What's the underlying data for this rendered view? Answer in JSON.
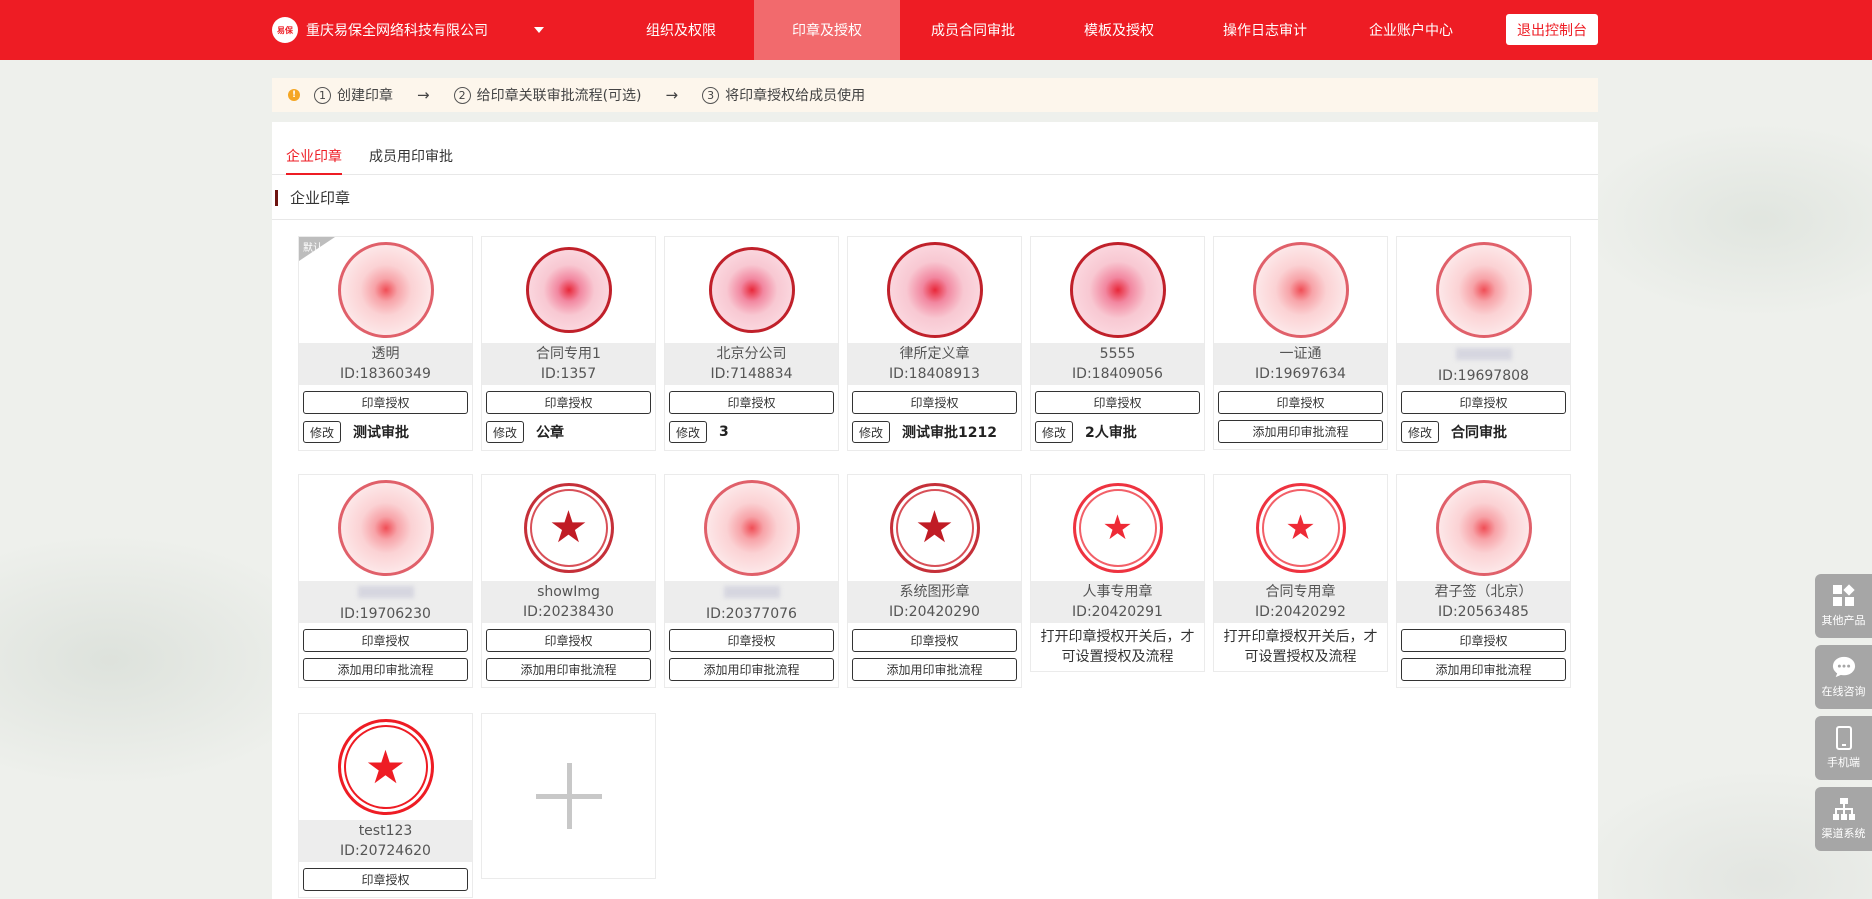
{
  "header": {
    "logo_text": "易保",
    "company_name": "重庆易保全网络科技有限公司",
    "nav": [
      "组织及权限",
      "印章及授权",
      "成员合同审批",
      "模板及授权",
      "操作日志审计",
      "企业账户中心"
    ],
    "active_nav_index": 1,
    "exit_label": "退出控制台"
  },
  "steps": [
    {
      "num": "1",
      "label": "创建印章"
    },
    {
      "num": "2",
      "label": "给印章关联审批流程(可选)"
    },
    {
      "num": "3",
      "label": "将印章授权给成员使用"
    }
  ],
  "tabs": [
    "企业印章",
    "成员用印审批"
  ],
  "section_title": "企业印章",
  "colors": {
    "brand": "#ee1c24",
    "active_nav": "#f26a6d",
    "steps_bg": "#fdf6ec"
  },
  "labels": {
    "authorize": "印章授权",
    "edit": "修改",
    "add_flow": "添加用印审批流程",
    "notice": "打开印章授权开关后，才可设置授权及流程",
    "default_badge": "默认"
  },
  "seals": [
    {
      "name": "透明",
      "id": "ID:18360349",
      "flow": "测试审批"
    },
    {
      "name": "合同专用1",
      "id": "ID:1357",
      "flow": "公章"
    },
    {
      "name": "北京分公司",
      "id": "ID:7148834",
      "flow": "3"
    },
    {
      "name": "律所定义章",
      "id": "ID:18408913",
      "flow": "测试审批1212"
    },
    {
      "name": "5555",
      "id": "ID:18409056",
      "flow": "2人审批"
    },
    {
      "name": "一证通",
      "id": "ID:19697634",
      "flow": ""
    },
    {
      "name": "",
      "id": "ID:19697808",
      "flow": "合同审批"
    },
    {
      "name": "",
      "id": "ID:19706230",
      "flow": ""
    },
    {
      "name": "showImg",
      "id": "ID:20238430",
      "flow": ""
    },
    {
      "name": "",
      "id": "ID:20377076",
      "flow": ""
    },
    {
      "name": "系统图形章",
      "id": "ID:20420290",
      "flow": ""
    },
    {
      "name": "人事专用章",
      "id": "ID:20420291",
      "flow": ""
    },
    {
      "name": "合同专用章",
      "id": "ID:20420292",
      "flow": ""
    },
    {
      "name": "君子签（北京）",
      "id": "ID:20563485",
      "flow": ""
    },
    {
      "name": "test123",
      "id": "ID:20724620",
      "flow": ""
    }
  ],
  "side_widgets": [
    {
      "label": "其他产品",
      "icon": "grid-icon"
    },
    {
      "label": "在线咨询",
      "icon": "chat-icon"
    },
    {
      "label": "手机端",
      "icon": "phone-icon"
    },
    {
      "label": "渠道系统",
      "icon": "hierarchy-icon"
    }
  ]
}
